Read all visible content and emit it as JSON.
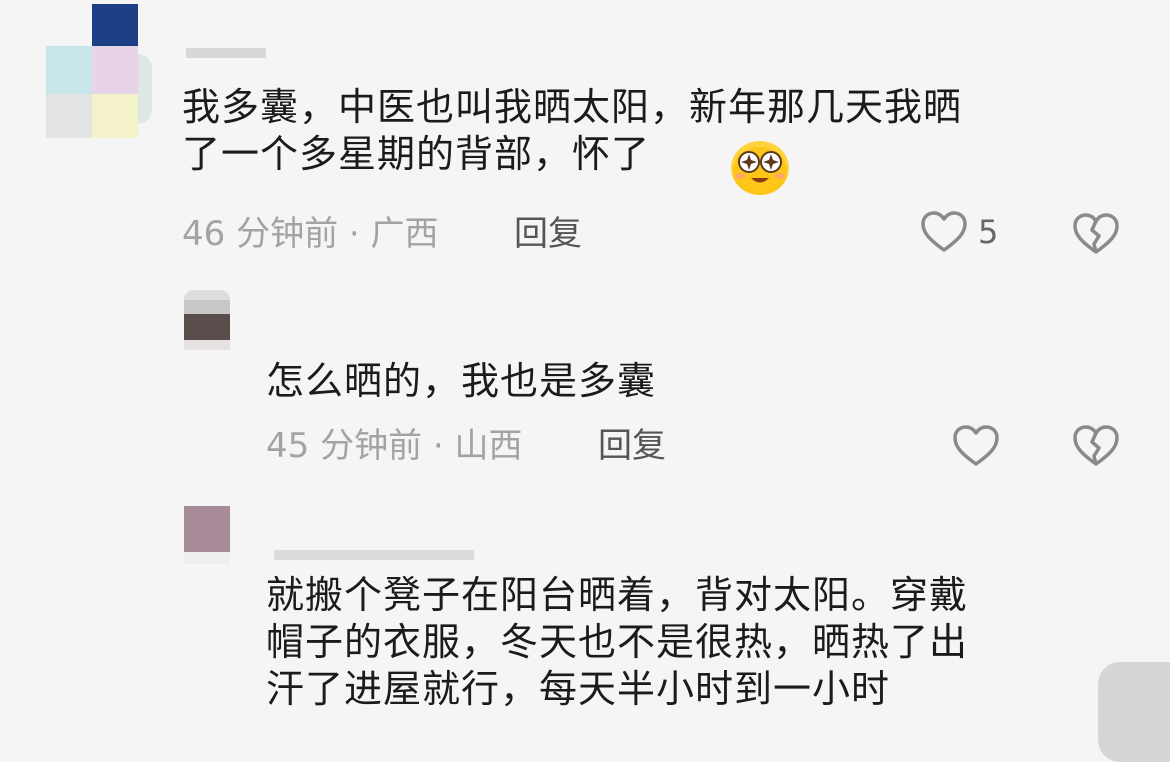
{
  "comments": [
    {
      "text": "我多囊，中医也叫我晒太阳，新年那几天我晒\n了一个多星期的背部，怀了",
      "emoji": "face-with-starry-eyes-emoji",
      "meta": "46 分钟前 · 广西",
      "reply_label": "回复",
      "like_count": "5"
    },
    {
      "text": "怎么晒的，我也是多囊",
      "meta": "45 分钟前 · 山西",
      "reply_label": "回复"
    },
    {
      "text": "就搬个凳子在阳台晒着，背对太阳。穿戴\n帽子的衣服，冬天也不是很热，晒热了出\n汗了进屋就行，每天半小时到一小时"
    }
  ],
  "colors": {
    "background": "#f5f5f5",
    "text": "#1b1b1b",
    "meta": "#a3a3a3",
    "reply": "#555555",
    "icon": "#8a8a8a"
  },
  "icons": {
    "like": "heart-outline-icon",
    "dislike": "broken-heart-icon"
  }
}
